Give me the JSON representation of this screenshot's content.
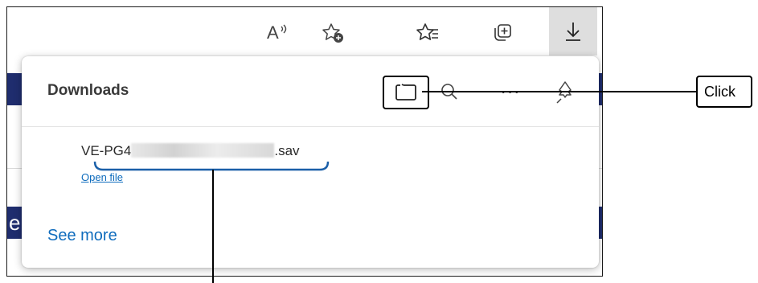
{
  "toolbar": {
    "icons": [
      "read-aloud-icon",
      "add-favorite-icon",
      "favorites-icon",
      "collections-icon",
      "downloads-icon"
    ],
    "read_aloud_glyph": "A"
  },
  "downloads": {
    "title": "Downloads",
    "actions": [
      "open-folder-icon",
      "search-icon",
      "more-icon",
      "pin-icon"
    ],
    "more_glyph": "···",
    "file": {
      "name_prefix": "VE-PG4",
      "name_suffix": ".sav",
      "open_label": "Open file"
    },
    "see_more_label": "See more"
  },
  "page": {
    "edge_char": "e"
  },
  "callout": {
    "label": "Click"
  },
  "colors": {
    "link": "#0f6cbd",
    "page_band": "#1f2d6e",
    "bracket": "#1a5fa8",
    "active_toolbar_bg": "#dedede"
  }
}
